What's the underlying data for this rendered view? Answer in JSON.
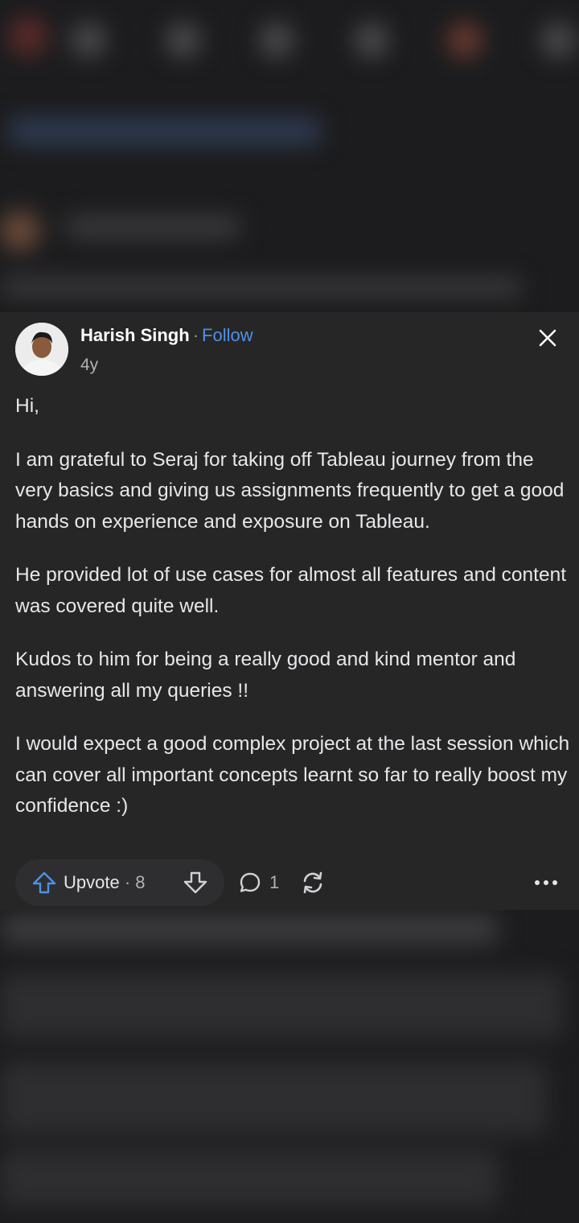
{
  "post": {
    "author": "Harish Singh",
    "separator": "·",
    "follow_label": "Follow",
    "time_ago": "4y",
    "paragraphs": [
      "Hi,",
      "I am grateful to Seraj for taking off Tableau journey from the very basics and giving us assignments frequently to get a good hands on experience and exposure on Tableau.",
      "He provided lot of use cases for almost all features and content was covered quite well.",
      "Kudos to him for being a really good and kind mentor and answering all my queries !!",
      "I would expect a good complex project at the last session which can cover all important concepts learnt so far to really boost my confidence :)"
    ]
  },
  "actions": {
    "upvote_label": "Upvote",
    "upvote_count": "· 8",
    "comment_count": "1"
  },
  "icons": {
    "close": "close-icon",
    "upvote": "arrow-up-icon",
    "downvote": "arrow-down-icon",
    "comment": "comment-bubble-icon",
    "share": "share-sync-icon",
    "more": "more-dots-icon"
  },
  "colors": {
    "accent": "#4f90e6",
    "card_bg": "#262627",
    "page_bg": "#1c1c1e"
  }
}
